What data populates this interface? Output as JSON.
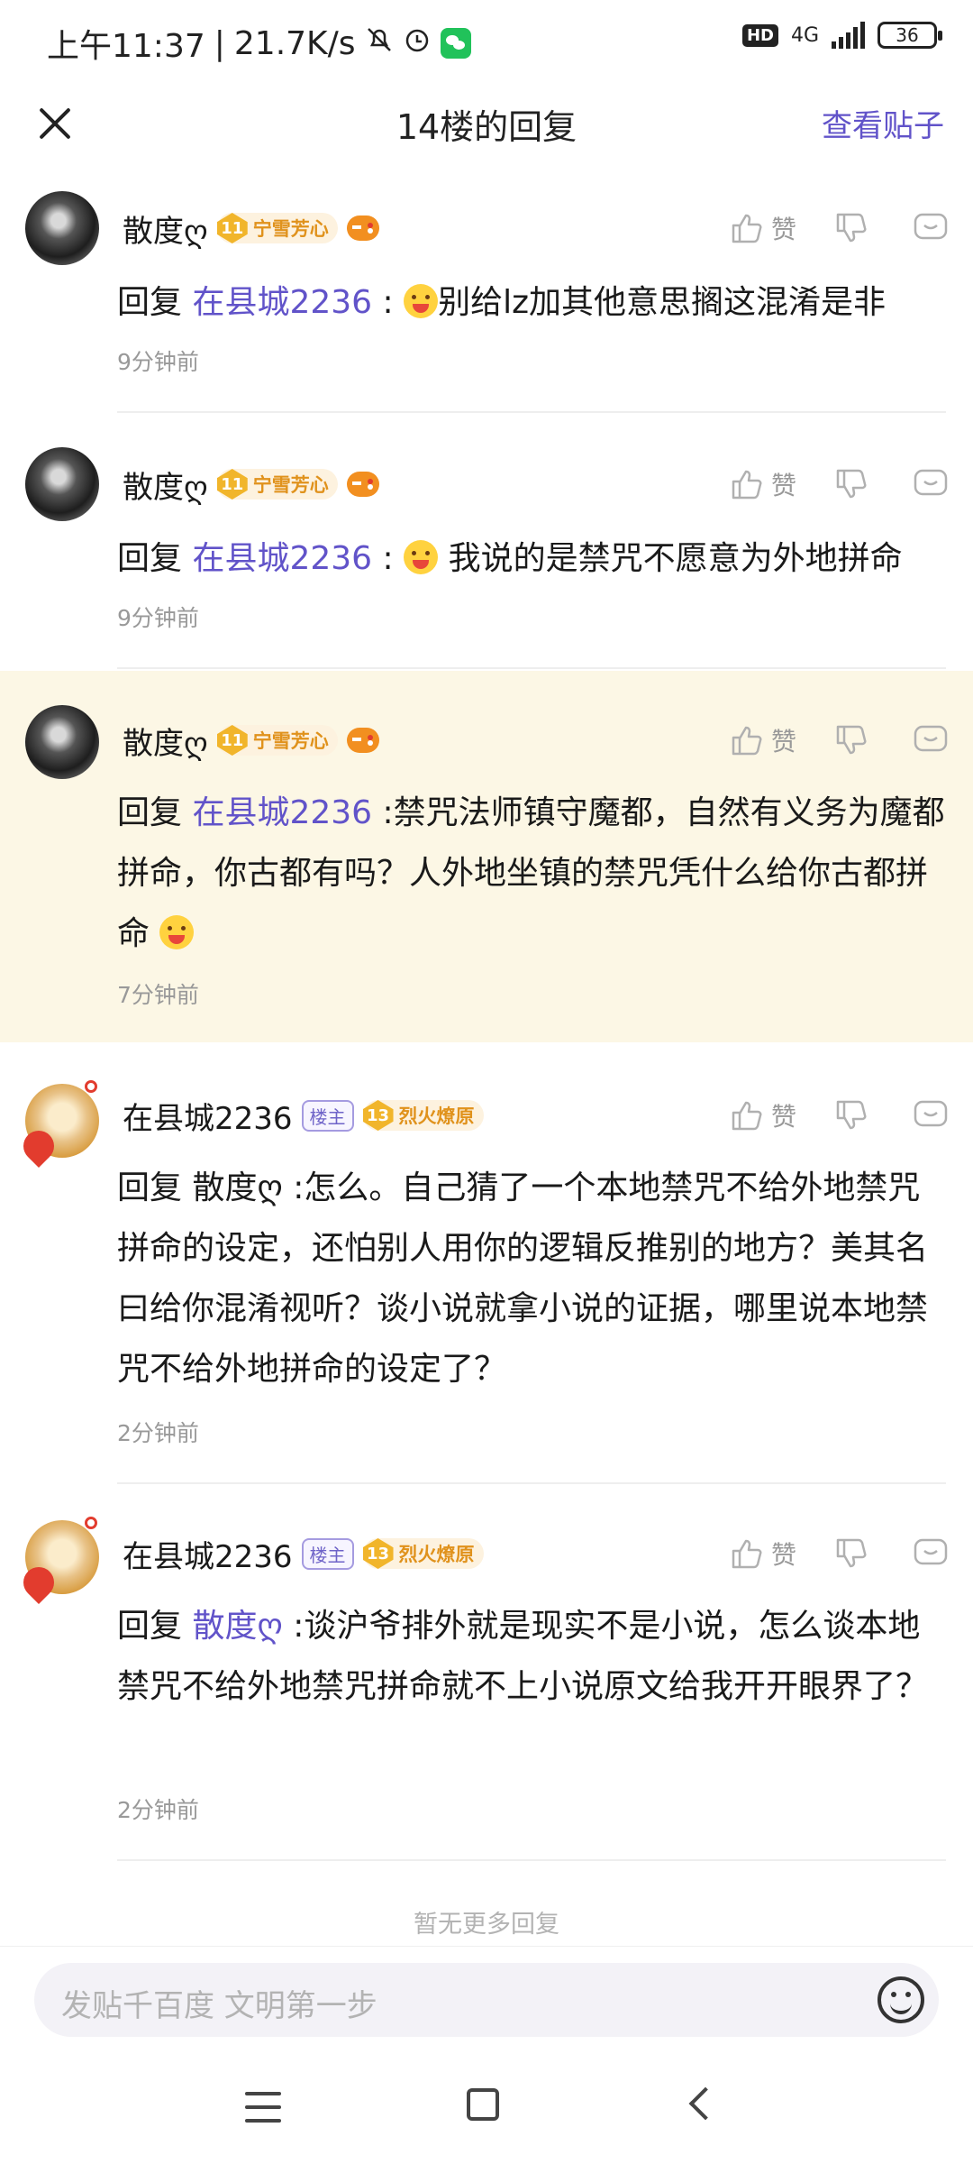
{
  "status_bar": {
    "time": "上午11:37",
    "speed": "21.7K/s",
    "hd": "HD",
    "network": "4G",
    "battery": "36"
  },
  "header": {
    "title": "14楼的回复",
    "view_post": "查看贴子"
  },
  "common": {
    "reply_prefix": "回复",
    "like_label": "赞",
    "lz_badge": "楼主"
  },
  "comments": [
    {
      "user": "散度ღ",
      "level": "11",
      "level_title": "宁雪芳心",
      "reply_to": "在县城2236",
      "sep": " :",
      "text": "别给lz加其他意思搁这混淆是非",
      "time": "9分钟前"
    },
    {
      "user": "散度ღ",
      "level": "11",
      "level_title": "宁雪芳心",
      "reply_to": "在县城2236",
      "sep": " :",
      "text": " 我说的是禁咒不愿意为外地拼命",
      "time": "9分钟前"
    },
    {
      "user": "散度ღ",
      "level": "11",
      "level_title": "宁雪芳心",
      "reply_to": "在县城2236",
      "sep": " :",
      "text": "禁咒法师镇守魔都，自然有义务为魔都拼命，你古都有吗？人外地坐镇的禁咒凭什么给你古都拼命 ",
      "time": "7分钟前"
    },
    {
      "user": "在县城2236",
      "level": "13",
      "level_title": "烈火燎原",
      "reply_to": "散度ღ",
      "sep": " :",
      "text": "怎么。自己猜了一个本地禁咒不给外地禁咒拼命的设定，还怕别人用你的逻辑反推别的地方？美其名曰给你混淆视听？谈小说就拿小说的证据，哪里说本地禁咒不给外地拼命的设定了？",
      "time": "2分钟前"
    },
    {
      "user": "在县城2236",
      "level": "13",
      "level_title": "烈火燎原",
      "reply_to": "散度ღ",
      "sep": " :",
      "text": "谈沪爷排外就是现实不是小说，怎么谈本地禁咒不给外地禁咒拼命就不上小说原文给我开开眼界了？",
      "time": "2分钟前"
    }
  ],
  "footer": {
    "no_more": "暂无更多回复",
    "input_placeholder": "发贴千百度 文明第一步"
  },
  "colors": {
    "accent": "#6153c9",
    "highlight_bg": "#fcf7e5",
    "level_gold": "#f1b52b"
  },
  "icons": [
    "close-icon",
    "thumb-up-icon",
    "thumb-down-icon",
    "comment-icon",
    "emoji-icon",
    "game-icon",
    "level-icon"
  ]
}
